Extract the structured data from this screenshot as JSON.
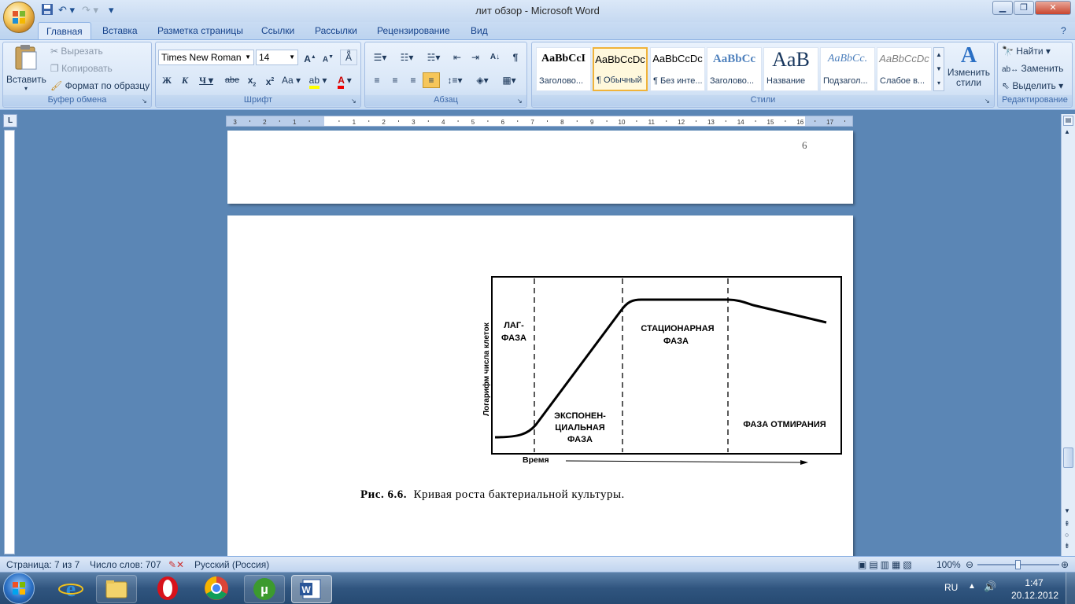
{
  "window": {
    "title": "лит обзор - Microsoft Word"
  },
  "tabs": [
    "Главная",
    "Вставка",
    "Разметка страницы",
    "Ссылки",
    "Рассылки",
    "Рецензирование",
    "Вид"
  ],
  "clipboard": {
    "paste": "Вставить",
    "cut": "Вырезать",
    "copy": "Копировать",
    "format_painter": "Формат по образцу",
    "label": "Буфер обмена"
  },
  "font": {
    "name": "Times New Roman",
    "size": "14",
    "label": "Шрифт"
  },
  "paragraph": {
    "label": "Абзац"
  },
  "styles": {
    "items": [
      {
        "preview": "AaBbCcI",
        "name": "Заголово..."
      },
      {
        "preview": "AaBbCcDc",
        "name": "¶ Обычный"
      },
      {
        "preview": "AaBbCcDc",
        "name": "¶ Без инте..."
      },
      {
        "preview": "AaBbCc",
        "name": "Заголово..."
      },
      {
        "preview": "AaB",
        "name": "Название"
      },
      {
        "preview": "AaBbCc.",
        "name": "Подзагол..."
      },
      {
        "preview": "AaBbCcDc",
        "name": "Слабое в..."
      }
    ],
    "change": "Изменить стили",
    "label": "Стили"
  },
  "editing": {
    "find": "Найти",
    "replace": "Заменить",
    "select": "Выделить",
    "label": "Редактирование"
  },
  "document": {
    "page_number": "6",
    "figure": {
      "ylabel": "Логарифм числа клеток",
      "xlabel": "Время",
      "phase_lag": [
        "ЛАГ-",
        "ФАЗА"
      ],
      "phase_exp": [
        "ЭКСПОНЕН-",
        "ЦИАЛЬНАЯ",
        "ФАЗА"
      ],
      "phase_stat": [
        "СТАЦИОНАРНАЯ",
        "ФАЗА"
      ],
      "phase_death": "ФАЗА ОТМИРАНИЯ"
    },
    "caption_num": "Рис. 6.6.",
    "caption_text": "Кривая роста бактериальной культуры."
  },
  "status": {
    "page": "Страница: 7 из 7",
    "words": "Число слов: 707",
    "language": "Русский (Россия)",
    "zoom": "100%"
  },
  "tray": {
    "lang": "RU",
    "time": "1:47",
    "date": "20.12.2012"
  }
}
